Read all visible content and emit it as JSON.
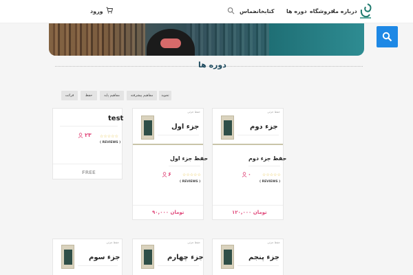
{
  "header": {
    "nav": {
      "about": "درباره ما",
      "shop": "فروشگاه",
      "courses": "دوره ها",
      "library": "کتابخانه",
      "contact": "تماس"
    },
    "login": "ورود"
  },
  "section": {
    "title": "دوره ها"
  },
  "filters": [
    "تجوید",
    "مفاهیم پیشرفته",
    "مفاهیم پایه",
    "حفظ",
    "قرائت"
  ],
  "cards": [
    {
      "tag": "حفظ جزئی",
      "title": "جزء دوم",
      "subtitle": "حفظ جزء دوم",
      "reviews": "( REVIEWS )",
      "students": "۰",
      "price": "۱۲۰,۰۰۰ تومان"
    },
    {
      "tag": "حفظ جزئی",
      "title": "جزء اول",
      "subtitle": "حفظ جزء اول",
      "reviews": "( REVIEWS )",
      "students": "۶",
      "price": "۹۰,۰۰۰ تومان"
    },
    {
      "title": "test",
      "reviews": "( REVIEWS )",
      "students": "۲۳",
      "price": "FREE"
    },
    {
      "tag": "حفظ جزئی",
      "title": "جزء پنجم"
    },
    {
      "tag": "حفظ جزئی",
      "title": "جزء چهارم"
    },
    {
      "tag": "حفظ جزئی",
      "title": "جزء سوم"
    }
  ],
  "colors": {
    "accent": "#1e88e5",
    "price": "#e0487a",
    "title": "#1e4a5e"
  }
}
